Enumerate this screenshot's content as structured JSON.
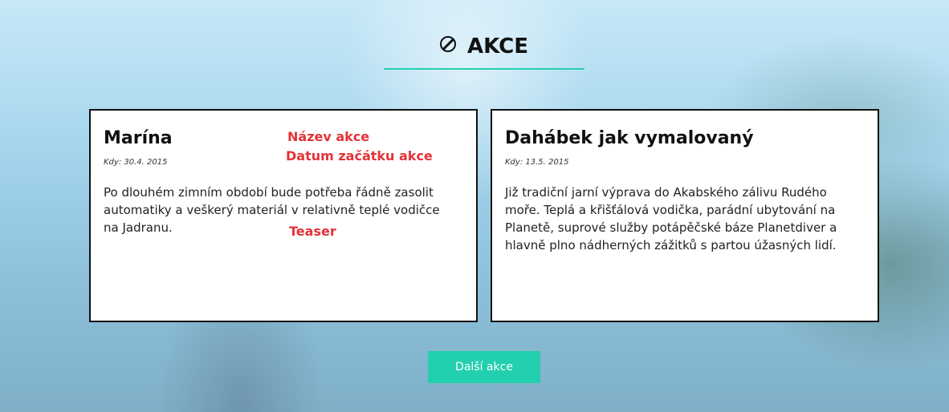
{
  "section": {
    "title": "AKCE",
    "icon": "prohibited-icon",
    "accent_color": "#24d0b0"
  },
  "events": [
    {
      "title": "Marína",
      "date": "Kdy: 30.4. 2015",
      "teaser": "Po dlouhém zimním období bude potřeba řádně zasolit automatiky a veškerý materiál v relativně teplé vodičce na Jadranu."
    },
    {
      "title": "Dahábek jak vymalovaný",
      "date": "Kdy: 13.5. 2015",
      "teaser": "Již tradiční jarní výprava do Akabského zálivu Rudého moře. Teplá a křišťálová vodička, parádní ubytování na Planetě, suprové služby potápěčské báze Planetdiver a hlavně plno nádherných zážitků s partou úžasných lidí."
    }
  ],
  "annotations": {
    "name_label": "Název akce",
    "date_label": "Datum začátku akce",
    "teaser_label": "Teaser",
    "color": "#e53237"
  },
  "more_button": {
    "label": "Další akce",
    "color": "#22cfae"
  }
}
